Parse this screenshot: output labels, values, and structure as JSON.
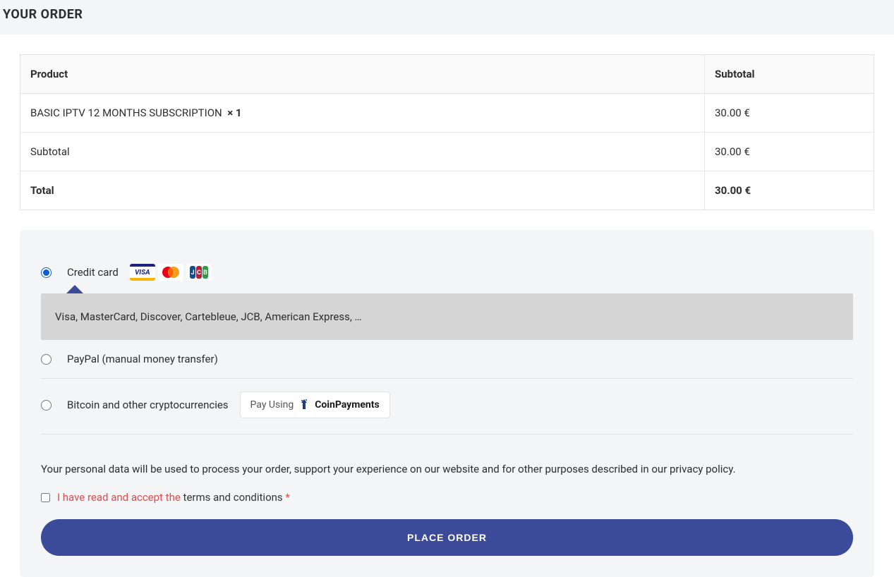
{
  "header": {
    "title": "YOUR ORDER"
  },
  "table": {
    "headers": {
      "product": "Product",
      "subtotal": "Subtotal"
    },
    "item": {
      "name": "BASIC IPTV 12 MONTHS SUBSCRIPTION",
      "qty": "× 1",
      "price": "30.00 €"
    },
    "subtotal": {
      "label": "Subtotal",
      "value": "30.00 €"
    },
    "total": {
      "label": "Total",
      "value": "30.00 €"
    }
  },
  "payment": {
    "credit_card": {
      "label": "Credit card",
      "description": "Visa, MasterCard, Discover, Cartebleue, JCB, American Express, …"
    },
    "paypal": {
      "label": "PayPal (manual money transfer)"
    },
    "crypto": {
      "label": "Bitcoin and other cryptocurrencies",
      "badge_prefix": "Pay Using",
      "badge_brand": "CoinPayments"
    }
  },
  "privacy": {
    "text": "Your personal data will be used to process your order, support your experience on our website and for other purposes described in our privacy policy."
  },
  "terms": {
    "prefix": "I have read and accept the ",
    "link": "terms and conditions",
    "required": "*"
  },
  "button": {
    "place_order": "PLACE ORDER"
  }
}
